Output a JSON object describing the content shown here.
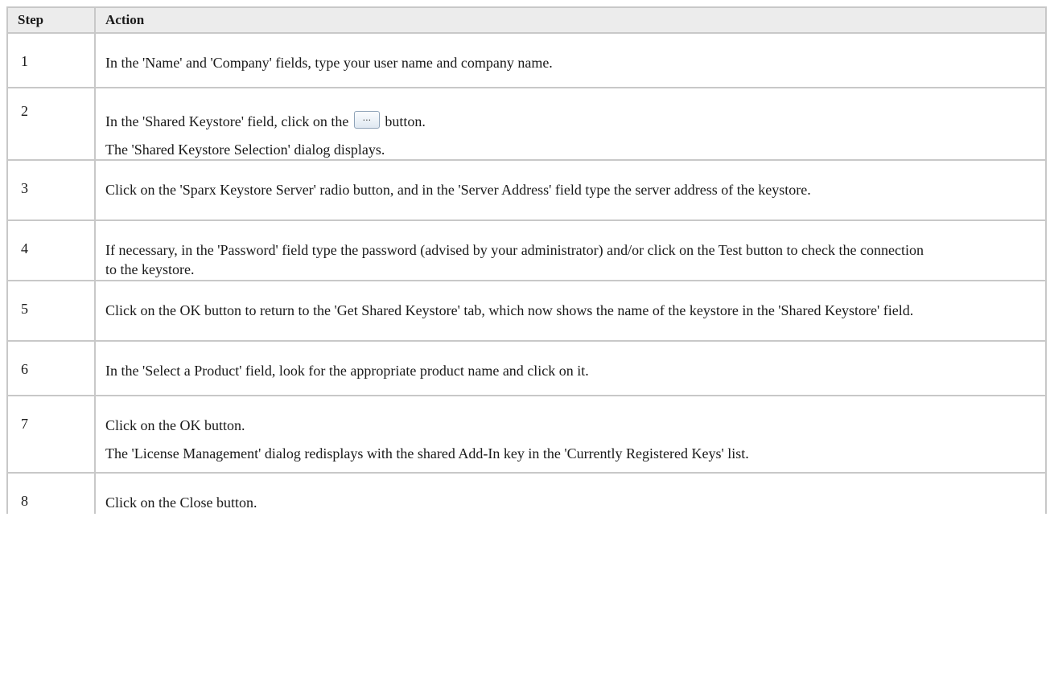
{
  "headers": {
    "step": "Step",
    "action": "Action"
  },
  "rows": [
    {
      "step": "1",
      "lines": [
        "In the 'Name' and 'Company' fields, type your user name and company name."
      ]
    },
    {
      "step": "2",
      "lines_pre": "In the 'Shared Keystore' field, click on the",
      "button_glyph": "...",
      "lines_post": "button.",
      "line2": "The 'Shared Keystore Selection' dialog displays."
    },
    {
      "step": "3",
      "lines": [
        "Click on the 'Sparx Keystore Server' radio button, and in the 'Server Address' field type the server address of the keystore."
      ]
    },
    {
      "step": "4",
      "lines": [
        "If necessary, in the 'Password' field type the password (advised by your administrator) and/or click on the Test button to check the connection to the keystore."
      ]
    },
    {
      "step": "5",
      "lines": [
        "Click on the OK button to return to the 'Get Shared Keystore' tab, which now shows the name of the keystore in the 'Shared Keystore' field."
      ]
    },
    {
      "step": "6",
      "lines": [
        "In the 'Select a Product' field, look for the appropriate product name and click on it."
      ]
    },
    {
      "step": "7",
      "lines": [
        "Click on the OK button.",
        "The 'License Management' dialog redisplays with the shared Add-In key in the 'Currently Registered Keys' list."
      ]
    },
    {
      "step": "8",
      "lines": [
        "Click on the Close button."
      ]
    }
  ]
}
